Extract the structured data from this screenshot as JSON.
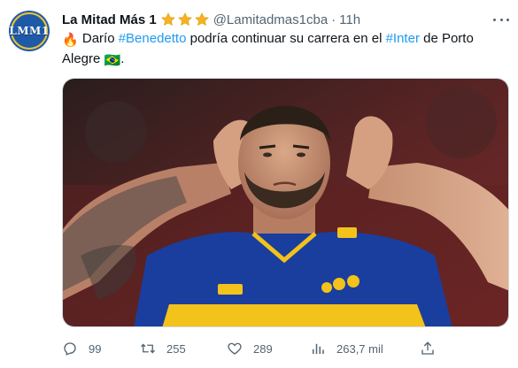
{
  "tweet": {
    "avatar_text": "LMM1",
    "display_name": "La Mitad Más 1",
    "handle": "@Lamitadmas1cba",
    "separator": "·",
    "time": "11h",
    "text": {
      "fire_emoji": "🔥",
      "part1": " Darío ",
      "hashtag1": "#Benedetto",
      "part2": " podría continuar su carrera en el ",
      "hashtag2": "#Inter",
      "part3": " de Porto",
      "part4": "Alegre ",
      "flag_emoji": "🇧🇷",
      "part5": "."
    }
  },
  "actions": {
    "replies": "99",
    "retweets": "255",
    "likes": "289",
    "views": "263,7 mil"
  },
  "colors": {
    "hashtag": "#1d9bf0",
    "secondary_text": "#536471",
    "star": "#f5b323",
    "jersey_blue": "#1a3e9e",
    "jersey_yellow": "#f3c21b"
  },
  "icons": {
    "verified_stars": "three-gold-stars",
    "reply": "reply-icon",
    "retweet": "retweet-icon",
    "like": "heart-icon",
    "views": "views-icon",
    "share": "share-icon",
    "more": "more-icon"
  }
}
